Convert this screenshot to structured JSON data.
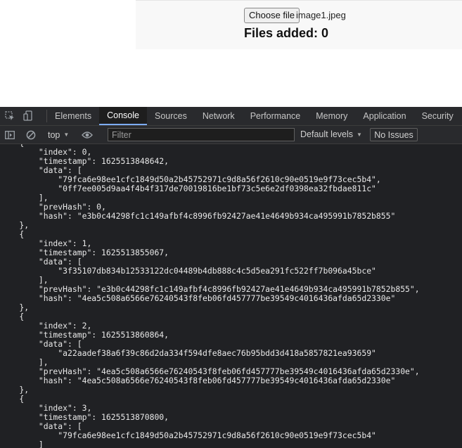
{
  "upload": {
    "choose_label": "Choose file",
    "file_name": "image1.jpeg",
    "files_added": "Files added: 0"
  },
  "devtools": {
    "icons": [
      "inspect-element-icon",
      "device-toolbar-icon",
      "sidebar-toggle-icon",
      "clear-console-icon",
      "eye-icon"
    ],
    "tabs": [
      "Elements",
      "Console",
      "Sources",
      "Network",
      "Performance",
      "Memory",
      "Application",
      "Security"
    ],
    "active_tab": "Console",
    "toolbar": {
      "context": "top",
      "filter_placeholder": "Filter",
      "levels": "Default levels",
      "issues": "No Issues"
    },
    "colors": {
      "background": "#202124",
      "active_tab_underline": "#7cacf8"
    }
  },
  "console_lines": [
    "    {",
    "        \"index\": 0,",
    "        \"timestamp\": 1625513848642,",
    "        \"data\": [",
    "            \"79fca6e98ee1cfc1849d50a2b45752971c9d8a56f2610c90e0519e9f73cec5b4\",",
    "            \"0ff7ee005d9aa4f4b4f317de70019816be1bf73c5e6e2df0398ea32fbdae811c\"",
    "        ],",
    "        \"prevHash\": 0,",
    "        \"hash\": \"e3b0c44298fc1c149afbf4c8996fb92427ae41e4649b934ca495991b7852b855\"",
    "    },",
    "    {",
    "        \"index\": 1,",
    "        \"timestamp\": 1625513855067,",
    "        \"data\": [",
    "            \"3f35107db834b12533122dc04489b4db888c4c5d5ea291fc522ff7b096a45bce\"",
    "        ],",
    "        \"prevHash\": \"e3b0c44298fc1c149afbf4c8996fb92427ae41e4649b934ca495991b7852b855\",",
    "        \"hash\": \"4ea5c508a6566e76240543f8feb06fd457777be39549c4016436afda65d2330e\"",
    "    },",
    "    {",
    "        \"index\": 2,",
    "        \"timestamp\": 1625513860864,",
    "        \"data\": [",
    "            \"a22aadef38a6f39c86d2da334f594dfe8aec76b95bdd3d418a5857821ea93659\"",
    "        ],",
    "        \"prevHash\": \"4ea5c508a6566e76240543f8feb06fd457777be39549c4016436afda65d2330e\",",
    "        \"hash\": \"4ea5c508a6566e76240543f8feb06fd457777be39549c4016436afda65d2330e\"",
    "    },",
    "    {",
    "        \"index\": 3,",
    "        \"timestamp\": 1625513870800,",
    "        \"data\": [",
    "            \"79fca6e98ee1cfc1849d50a2b45752971c9d8a56f2610c90e0519e9f73cec5b4\"",
    "        ]"
  ]
}
